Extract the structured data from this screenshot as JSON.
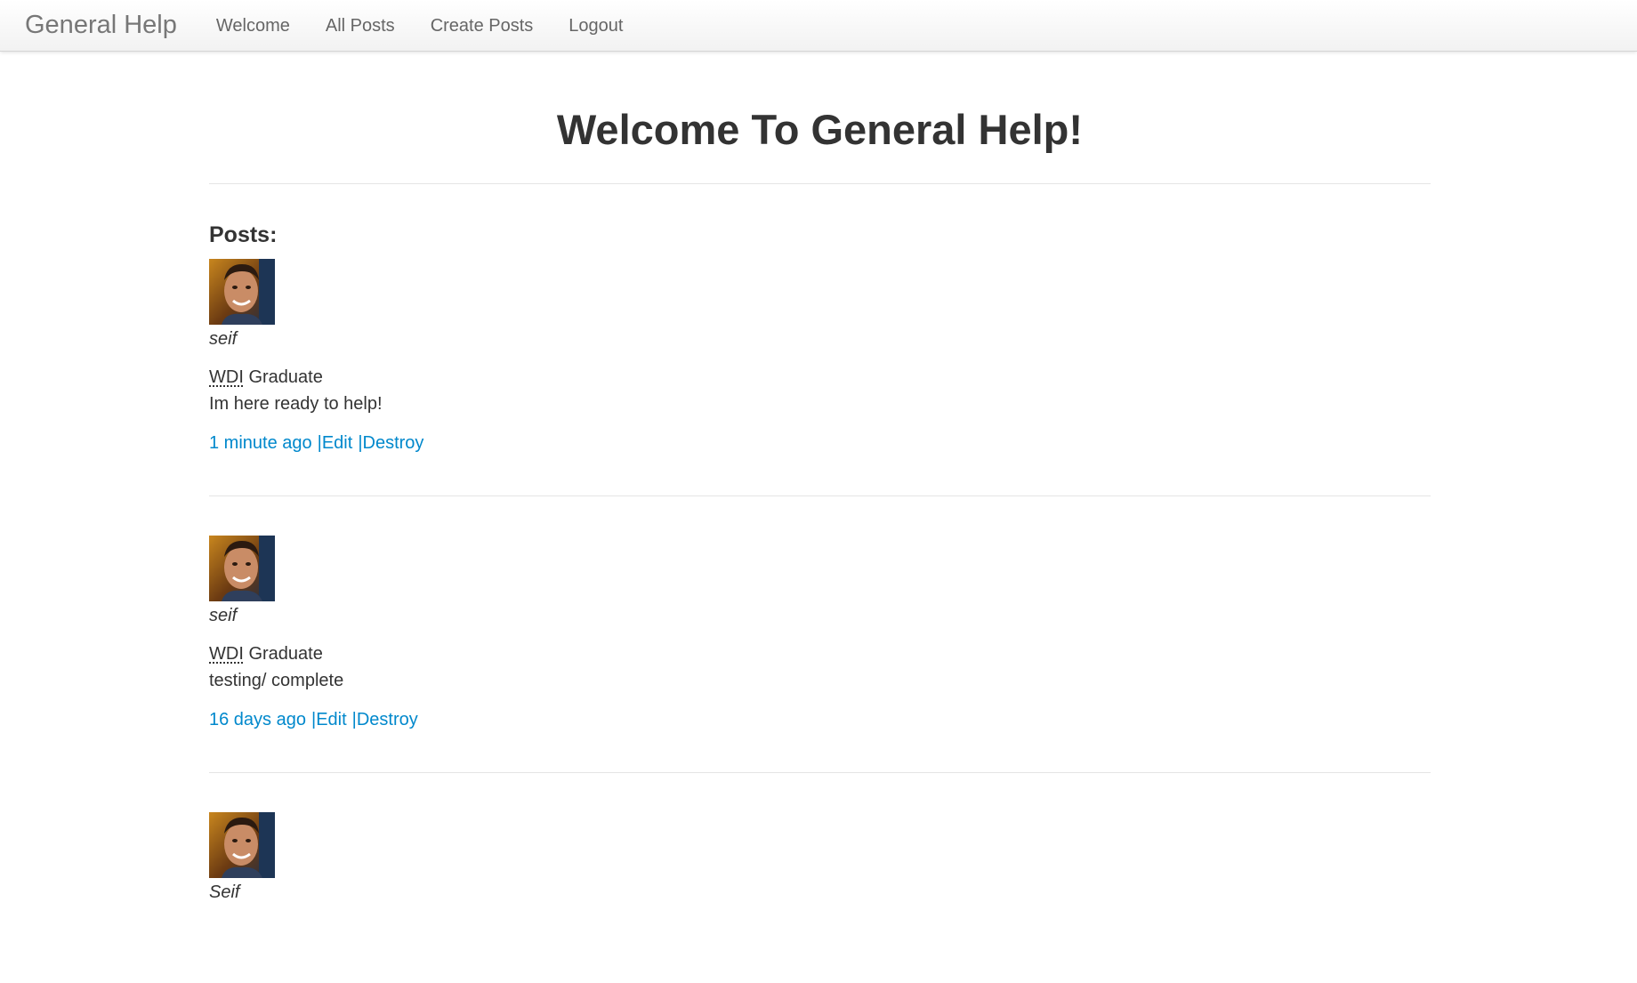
{
  "nav": {
    "brand": "General Help",
    "links": [
      "Welcome",
      "All Posts",
      "Create Posts",
      "Logout"
    ]
  },
  "header": {
    "title": "Welcome To General Help!"
  },
  "posts_heading": "Posts:",
  "posts": [
    {
      "author": "seif",
      "org_abbr": "WDI",
      "org_rest": " Graduate",
      "body": "Im here ready to help!",
      "time": "1 minute ago",
      "separator": "|",
      "edit": "Edit",
      "destroy": "Destroy"
    },
    {
      "author": "seif",
      "org_abbr": "WDI",
      "org_rest": " Graduate",
      "body": "testing/ complete",
      "time": "16 days ago",
      "separator": "|",
      "edit": "Edit",
      "destroy": "Destroy"
    },
    {
      "author": "Seif"
    }
  ],
  "colors": {
    "link": "#0088cc",
    "text": "#333333",
    "nav_text": "#666666",
    "brand_text": "#777777"
  }
}
